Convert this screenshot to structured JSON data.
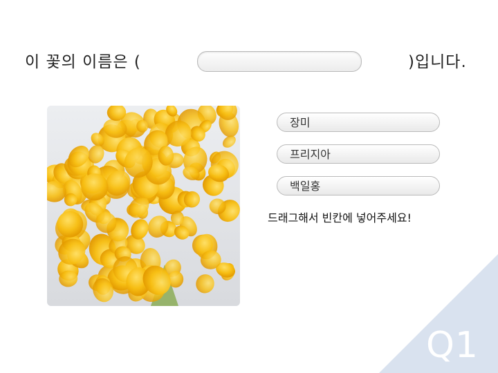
{
  "question": {
    "prefix": "이 꽃의 이름은 (",
    "suffix": ")입니다."
  },
  "answer_slot": {
    "value": ""
  },
  "photo": {
    "subject": "yellow freesia bouquet"
  },
  "options": [
    {
      "label": "장미"
    },
    {
      "label": "프리지아"
    },
    {
      "label": "백일홍"
    }
  ],
  "hint": "드래그해서 빈칸에 넣어주세요!",
  "badge": {
    "label": "Q1"
  },
  "colors": {
    "accent": "#d9e2ef",
    "flower": "#f5b400",
    "flower_light": "#ffd23a",
    "background": "#ffffff"
  }
}
